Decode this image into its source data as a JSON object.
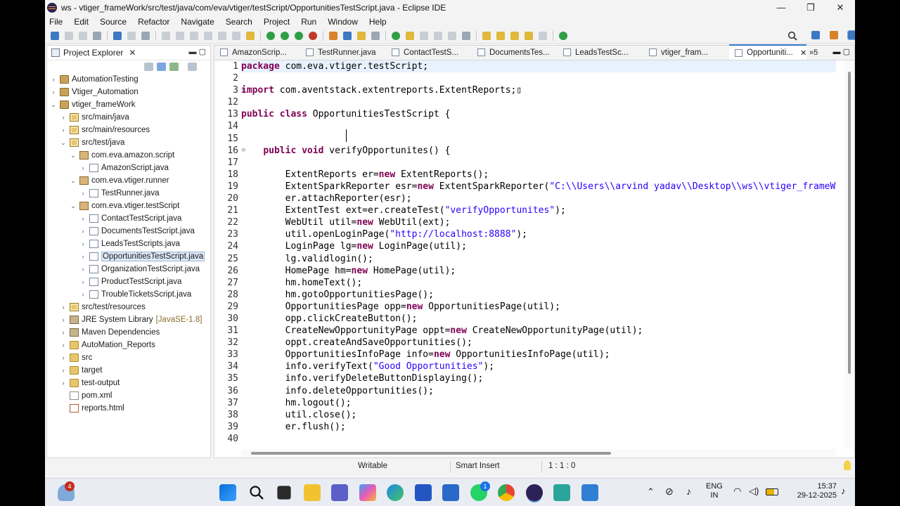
{
  "window": {
    "title": "ws - vtiger_frameWork/src/test/java/com/eva/vtiger/testScript/OpportunitiesTestScript.java - Eclipse IDE",
    "minimize": "—",
    "maximize": "❐",
    "close": "✕"
  },
  "menu": [
    "File",
    "Edit",
    "Source",
    "Refactor",
    "Navigate",
    "Search",
    "Project",
    "Run",
    "Window",
    "Help"
  ],
  "explorer": {
    "tab_label": "Project Explorer",
    "close_glyph": "✕",
    "view_controls": "▬ ▢",
    "tree": [
      {
        "indent": 0,
        "twisty": "›",
        "icon": "project-icon",
        "cls": "project",
        "label": "AutomationTesting"
      },
      {
        "indent": 0,
        "twisty": "›",
        "icon": "project-icon",
        "cls": "project",
        "label": "Vtiger_Automation"
      },
      {
        "indent": 0,
        "twisty": "⌄",
        "icon": "project-icon",
        "cls": "project",
        "label": "vtiger_frameWork"
      },
      {
        "indent": 1,
        "twisty": "›",
        "icon": "source-folder-icon",
        "cls": "srcf",
        "label": "src/main/java"
      },
      {
        "indent": 1,
        "twisty": "›",
        "icon": "source-folder-icon",
        "cls": "srcf",
        "label": "src/main/resources"
      },
      {
        "indent": 1,
        "twisty": "⌄",
        "icon": "source-folder-icon",
        "cls": "srcf",
        "label": "src/test/java"
      },
      {
        "indent": 2,
        "twisty": "⌄",
        "icon": "package-icon",
        "cls": "pkg",
        "label": "com.eva.amazon.script"
      },
      {
        "indent": 3,
        "twisty": "›",
        "icon": "java-file-icon",
        "cls": "java",
        "label": "AmazonScript.java"
      },
      {
        "indent": 2,
        "twisty": "⌄",
        "icon": "package-icon",
        "cls": "pkg",
        "label": "com.eva.vtiger.runner"
      },
      {
        "indent": 3,
        "twisty": "›",
        "icon": "java-file-icon",
        "cls": "java",
        "label": "TestRunner.java"
      },
      {
        "indent": 2,
        "twisty": "⌄",
        "icon": "package-icon",
        "cls": "pkg",
        "label": "com.eva.vtiger.testScript"
      },
      {
        "indent": 3,
        "twisty": "›",
        "icon": "java-file-icon",
        "cls": "java",
        "label": "ContactTestScript.java"
      },
      {
        "indent": 3,
        "twisty": "›",
        "icon": "java-file-icon",
        "cls": "java",
        "label": "DocumentsTestScript.java"
      },
      {
        "indent": 3,
        "twisty": "›",
        "icon": "java-file-icon",
        "cls": "java",
        "label": "LeadsTestScripts.java"
      },
      {
        "indent": 3,
        "twisty": "›",
        "icon": "java-file-icon",
        "cls": "java",
        "label": "OpportunitiesTestScript.java",
        "selected": true
      },
      {
        "indent": 3,
        "twisty": "›",
        "icon": "java-file-icon",
        "cls": "java",
        "label": "OrganizationTestScript.java"
      },
      {
        "indent": 3,
        "twisty": "›",
        "icon": "java-file-icon",
        "cls": "java",
        "label": "ProductTestScript.java"
      },
      {
        "indent": 3,
        "twisty": "›",
        "icon": "java-file-icon",
        "cls": "java",
        "label": "TroubleTicketsScript.java"
      },
      {
        "indent": 1,
        "twisty": "›",
        "icon": "source-folder-icon",
        "cls": "srcf",
        "label": "src/test/resources"
      },
      {
        "indent": 1,
        "twisty": "›",
        "icon": "library-icon",
        "cls": "lib",
        "label": "JRE System Library",
        "suffix": "[JavaSE-1.8]"
      },
      {
        "indent": 1,
        "twisty": "›",
        "icon": "library-icon",
        "cls": "lib",
        "label": "Maven Dependencies"
      },
      {
        "indent": 1,
        "twisty": "›",
        "icon": "folder-icon",
        "cls": "folder",
        "label": "AutoMation_Reports"
      },
      {
        "indent": 1,
        "twisty": "›",
        "icon": "folder-icon",
        "cls": "folder",
        "label": "src"
      },
      {
        "indent": 1,
        "twisty": "›",
        "icon": "folder-icon",
        "cls": "folder",
        "label": "target"
      },
      {
        "indent": 1,
        "twisty": "›",
        "icon": "folder-icon",
        "cls": "folder",
        "label": "test-output"
      },
      {
        "indent": 1,
        "twisty": "",
        "icon": "xml-file-icon",
        "cls": "file",
        "label": "pom.xml"
      },
      {
        "indent": 1,
        "twisty": "",
        "icon": "html-file-icon",
        "cls": "html",
        "label": "reports.html"
      }
    ]
  },
  "editor": {
    "tabs": [
      "AmazonScrip...",
      "TestRunner.java",
      "ContactTestS...",
      "DocumentsTes...",
      "LeadsTestSc...",
      "vtiger_fram...",
      "Opportuniti..."
    ],
    "active_tab_index": 6,
    "overflow": "»5",
    "view_controls": "▬ ▢",
    "lines": [
      {
        "n": "1",
        "html": "<span class='kw'>package</span> com.eva.vtiger.testScript;",
        "current": true
      },
      {
        "n": "2",
        "html": ""
      },
      {
        "n": "3",
        "fold": "⊕",
        "html": "<span class='kw'>import</span> com.aventstack.extentreports.ExtentReports;&#x25AF;"
      },
      {
        "n": "12",
        "html": ""
      },
      {
        "n": "13",
        "html": "<span class='kw'>public</span> <span class='kw'>class</span> OpportunitiesTestScript {"
      },
      {
        "n": "14",
        "html": ""
      },
      {
        "n": "15",
        "html": ""
      },
      {
        "n": "16",
        "fold": "⊖",
        "html": "    <span class='kw'>public</span> <span class='kw'>void</span> verifyOpportunites() {"
      },
      {
        "n": "17",
        "html": ""
      },
      {
        "n": "18",
        "html": "        ExtentReports er=<span class='kw'>new</span> ExtentReports();"
      },
      {
        "n": "19",
        "html": "        ExtentSparkReporter esr=<span class='kw'>new</span> ExtentSparkReporter(<span class='str'>\"C:\\\\Users\\\\arvind yadav\\\\Desktop\\\\ws\\\\vtiger_frameW</span>"
      },
      {
        "n": "20",
        "html": "        er.attachReporter(esr);"
      },
      {
        "n": "21",
        "html": "        ExtentTest ext=er.createTest(<span class='str'>\"verifyOpportunites\"</span>);"
      },
      {
        "n": "22",
        "html": "        WebUtil util=<span class='kw'>new</span> WebUtil(ext);"
      },
      {
        "n": "23",
        "html": "        util.openLoginPage(<span class='str'>\"http://localhost:8888\"</span>);"
      },
      {
        "n": "24",
        "html": "        LoginPage lg=<span class='kw'>new</span> LoginPage(util);"
      },
      {
        "n": "25",
        "html": "        lg.validlogin();"
      },
      {
        "n": "26",
        "html": "        HomePage hm=<span class='kw'>new</span> HomePage(util);"
      },
      {
        "n": "27",
        "html": "        hm.homeText();"
      },
      {
        "n": "28",
        "html": "        hm.gotoOpportunitiesPage();"
      },
      {
        "n": "29",
        "html": "        OpportunitiesPage opp=<span class='kw'>new</span> OpportunitiesPage(util);"
      },
      {
        "n": "30",
        "html": "        opp.clickCreateButton();"
      },
      {
        "n": "31",
        "html": "        CreateNewOpportunityPage oppt=<span class='kw'>new</span> CreateNewOpportunityPage(util);"
      },
      {
        "n": "32",
        "html": "        oppt.createAndSaveOpportunities();"
      },
      {
        "n": "33",
        "html": "        OpportunitiesInfoPage info=<span class='kw'>new</span> OpportunitiesInfoPage(util);"
      },
      {
        "n": "34",
        "html": "        info.verifyText(<span class='str'>\"Good Opportunities\"</span>);"
      },
      {
        "n": "35",
        "html": "        info.verifyDeleteButtonDisplaying();"
      },
      {
        "n": "36",
        "html": "        info.deleteOpportunities();"
      },
      {
        "n": "37",
        "html": "        hm.logout();"
      },
      {
        "n": "38",
        "html": "        util.close();"
      },
      {
        "n": "39",
        "html": "        er.flush();"
      },
      {
        "n": "40",
        "html": ""
      }
    ]
  },
  "status": {
    "writable": "Writable",
    "insert_mode": "Smart Insert",
    "position": "1 : 1 : 0"
  },
  "taskbar": {
    "weather_badge": "4",
    "whatsapp_badge": "1",
    "lang_top": "ENG",
    "lang_bottom": "IN",
    "time": "15:37",
    "date": "29-12-2025"
  }
}
